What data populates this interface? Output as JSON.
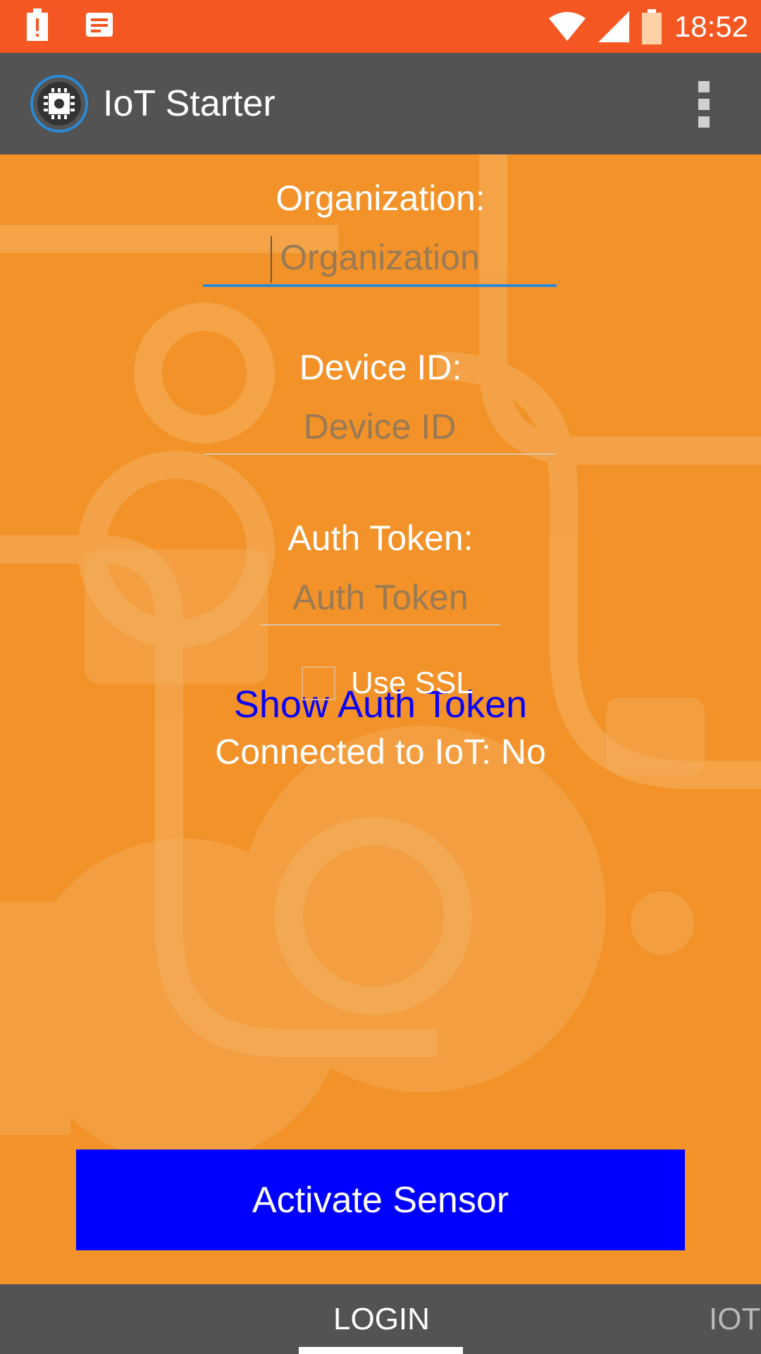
{
  "status_bar": {
    "time": "18:52",
    "icons": [
      "alert-icon",
      "notes-icon",
      "wifi-icon",
      "signal-icon",
      "battery-icon"
    ]
  },
  "app_bar": {
    "title": "IoT Starter",
    "logo_icon": "chip-icon",
    "menu_icon": "overflow-menu-icon"
  },
  "form": {
    "organization_label": "Organization:",
    "organization_placeholder": "Organization",
    "device_id_label": "Device ID:",
    "device_id_placeholder": "Device ID",
    "auth_token_label": "Auth Token:",
    "auth_token_placeholder": "Auth Token",
    "show_auth_token": "Show Auth Token",
    "use_ssl_label": "Use SSL",
    "use_ssl_checked": false,
    "connection_status": "Connected to IoT: No",
    "activate_button": "Activate Sensor"
  },
  "tabs": [
    {
      "label": "LOGIN",
      "selected": true
    },
    {
      "label": "IOT",
      "selected": false
    }
  ],
  "colors": {
    "status_bar": "#f55722",
    "app_bar": "#535353",
    "background": "#f29229",
    "link": "#0a00f5",
    "button": "#0000ff",
    "field_focus": "#2b8ad6"
  }
}
